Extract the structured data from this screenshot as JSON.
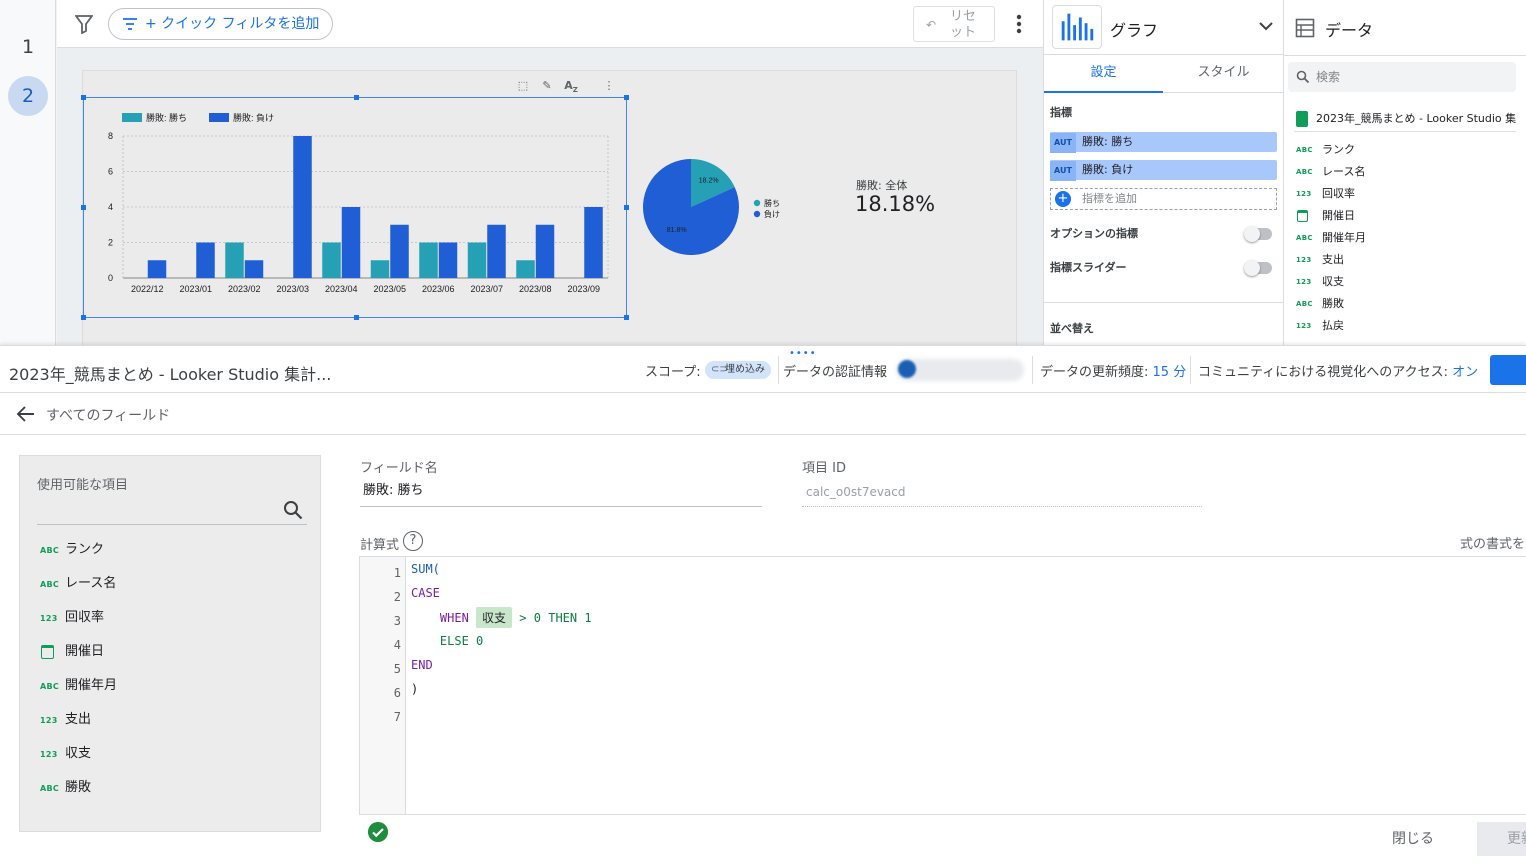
{
  "pages": [
    "1",
    "2"
  ],
  "filterbar": {
    "add_filter_label": "+ クイック フィルタを追加",
    "reset_label": "リセット"
  },
  "chart": {
    "legend": [
      "勝敗: 勝ち",
      "勝敗: 負け"
    ],
    "colors": {
      "win": "#26a0b5",
      "lose": "#1f5ed4"
    },
    "y_ticks": [
      "0",
      "2",
      "4",
      "6",
      "8"
    ]
  },
  "chart_data": [
    {
      "type": "bar",
      "categories": [
        "2022/12",
        "2023/01",
        "2023/02",
        "2023/03",
        "2023/04",
        "2023/05",
        "2023/06",
        "2023/07",
        "2023/08",
        "2023/09"
      ],
      "series": [
        {
          "name": "勝敗: 勝ち",
          "values": [
            0,
            0,
            2,
            0,
            2,
            1,
            2,
            2,
            1,
            0
          ]
        },
        {
          "name": "勝敗: 負け",
          "values": [
            1,
            2,
            1,
            8,
            4,
            3,
            2,
            3,
            3,
            4
          ]
        }
      ],
      "ylim": [
        0,
        8
      ],
      "legend": "top-left",
      "grid": true
    },
    {
      "type": "pie",
      "categories": [
        "勝ち",
        "負け"
      ],
      "values": [
        18.2,
        81.8
      ],
      "slice_labels": [
        "18.2%",
        "81.8%"
      ],
      "legend": "right"
    }
  ],
  "scorecard": {
    "label": "勝敗: 全体",
    "value": "18.18%"
  },
  "props_panel": {
    "chart_type": "グラフ",
    "tabs": [
      "設定",
      "スタイル"
    ],
    "metrics_title": "指標",
    "metrics": [
      {
        "badge": "AUT",
        "label": "勝敗: 勝ち"
      },
      {
        "badge": "AUT",
        "label": "勝敗: 負け"
      }
    ],
    "add_metric": "指標を追加",
    "optional_metrics": "オプションの指標",
    "metric_slider": "指標スライダー",
    "sort_title": "並べ替え"
  },
  "data_panel": {
    "title": "データ",
    "search_placeholder": "検索",
    "source": "2023年_競馬まとめ - Looker Studio 集...",
    "fields": [
      {
        "type": "ABC",
        "name": "ランク"
      },
      {
        "type": "ABC",
        "name": "レース名"
      },
      {
        "type": "123",
        "name": "回収率"
      },
      {
        "type": "date",
        "name": "開催日"
      },
      {
        "type": "ABC",
        "name": "開催年月"
      },
      {
        "type": "123",
        "name": "支出"
      },
      {
        "type": "123",
        "name": "収支"
      },
      {
        "type": "ABC",
        "name": "勝敗"
      },
      {
        "type": "123",
        "name": "払戻"
      }
    ]
  },
  "editor_header": {
    "datasource_title": "2023年_競馬まとめ - Looker Studio 集計...",
    "scope_label": "スコープ:",
    "scope_value": "埋め込み",
    "credentials_label": "データの認証情報",
    "freshness_label": "データの更新頻度:",
    "freshness_value": "15 分",
    "community_label": "コミュニティにおける視覚化へのアクセス:",
    "community_value": "オン"
  },
  "back_label": "すべてのフィールド",
  "available_fields": {
    "title": "使用可能な項目",
    "items": [
      {
        "type": "ABC",
        "name": "ランク"
      },
      {
        "type": "ABC",
        "name": "レース名"
      },
      {
        "type": "123",
        "name": "回収率"
      },
      {
        "type": "date",
        "name": "開催日"
      },
      {
        "type": "ABC",
        "name": "開催年月"
      },
      {
        "type": "123",
        "name": "支出"
      },
      {
        "type": "123",
        "name": "収支"
      },
      {
        "type": "ABC",
        "name": "勝敗"
      }
    ]
  },
  "field_form": {
    "name_label": "フィールド名",
    "name_value": "勝敗: 勝ち",
    "id_label": "項目 ID",
    "id_value": "calc_o0st7evacd",
    "formula_label": "計算式",
    "format_label": "式の書式を"
  },
  "formula": {
    "line_numbers": [
      "1",
      "2",
      "3",
      "4",
      "5",
      "6",
      "7"
    ],
    "sum": "SUM(",
    "case": "CASE",
    "when": "WHEN",
    "field": "収支",
    "gt": "> 0",
    "then": "THEN 1",
    "else": "ELSE 0",
    "end": "END",
    "close": ")"
  },
  "footer": {
    "close_label": "閉じる",
    "update_label": "更新"
  }
}
